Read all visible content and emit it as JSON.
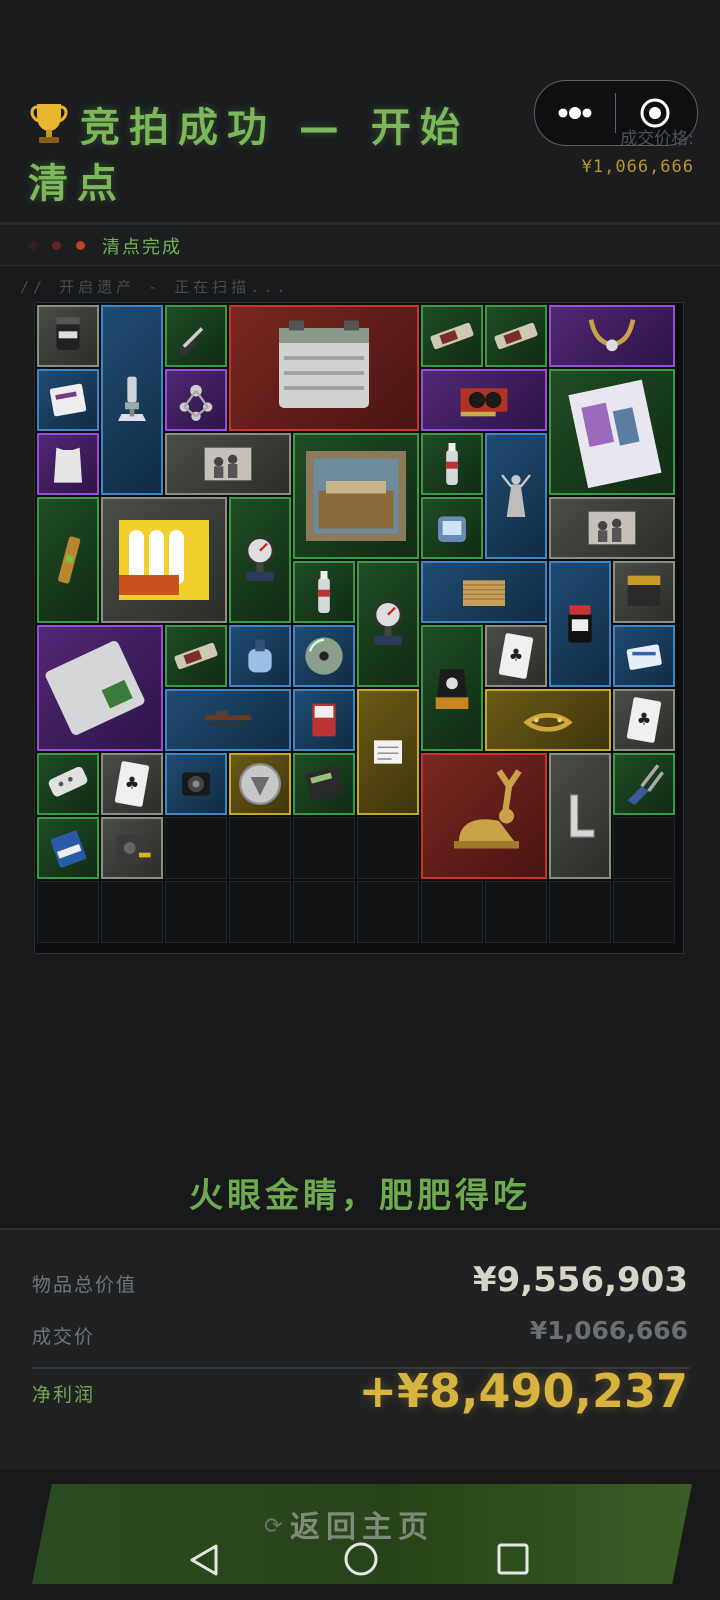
{
  "header": {
    "title": "竞拍成功 — 开始清点",
    "price_label": "成交价格:",
    "price_value": "¥1,066,666"
  },
  "capsule": {
    "more_icon": "more-dots-icon",
    "close_icon": "target-circle-icon"
  },
  "status": {
    "text": "清点完成",
    "dots": [
      "#3a1e1e",
      "#6b2222",
      "#c83a2e"
    ]
  },
  "scan": {
    "text": "// 开启遗产 - 正在扫描..."
  },
  "inventory": {
    "columns": 10,
    "rows": 10,
    "items": [
      {
        "name": "protein-jar",
        "rarity": "gray",
        "icon": "jar"
      },
      {
        "name": "microscope",
        "rarity": "blue",
        "icon": "microscope"
      },
      {
        "name": "screwdriver",
        "rarity": "green",
        "icon": "screwdriver"
      },
      {
        "name": "car-battery",
        "rarity": "red",
        "icon": "battery"
      },
      {
        "name": "snack-bar",
        "rarity": "green",
        "icon": "bar"
      },
      {
        "name": "snack-bar",
        "rarity": "green",
        "icon": "bar"
      },
      {
        "name": "horn-necklace",
        "rarity": "purple",
        "icon": "horns"
      },
      {
        "name": "medicine-pack",
        "rarity": "blue",
        "icon": "pack"
      },
      {
        "name": "molecule-model",
        "rarity": "purple",
        "icon": "molecule"
      },
      {
        "name": "graphics-card",
        "rarity": "purple",
        "icon": "gpu"
      },
      {
        "name": "magazine",
        "rarity": "green",
        "icon": "magazine"
      },
      {
        "name": "vest-plate",
        "rarity": "purple",
        "icon": "vest"
      },
      {
        "name": "old-photo",
        "rarity": "gray",
        "icon": "photo"
      },
      {
        "name": "painting",
        "rarity": "green",
        "icon": "painting"
      },
      {
        "name": "water-bottle",
        "rarity": "green",
        "icon": "bottle"
      },
      {
        "name": "statue",
        "rarity": "blue",
        "icon": "statue"
      },
      {
        "name": "spirit-level",
        "rarity": "green",
        "icon": "level"
      },
      {
        "name": "candles",
        "rarity": "gray",
        "icon": "candles"
      },
      {
        "name": "pressure-gauge",
        "rarity": "green",
        "icon": "gauge"
      },
      {
        "name": "device",
        "rarity": "green",
        "icon": "device"
      },
      {
        "name": "old-photo",
        "rarity": "gray",
        "icon": "photo"
      },
      {
        "name": "water-bottle",
        "rarity": "green",
        "icon": "bottle"
      },
      {
        "name": "pressure-gauge",
        "rarity": "green",
        "icon": "gauge"
      },
      {
        "name": "wicker-mat",
        "rarity": "blue",
        "icon": "mat"
      },
      {
        "name": "ink-bottle",
        "rarity": "blue",
        "icon": "ink"
      },
      {
        "name": "nails-box",
        "rarity": "gray",
        "icon": "box"
      },
      {
        "name": "hard-drive",
        "rarity": "purple",
        "icon": "hdd"
      },
      {
        "name": "snack-bar",
        "rarity": "green",
        "icon": "bar"
      },
      {
        "name": "fuel-tank",
        "rarity": "blue",
        "icon": "tank"
      },
      {
        "name": "cd-disc",
        "rarity": "blue",
        "icon": "disc"
      },
      {
        "name": "coffee-bag",
        "rarity": "green",
        "icon": "coffee"
      },
      {
        "name": "playing-card",
        "rarity": "gray",
        "icon": "card"
      },
      {
        "name": "pill-box",
        "rarity": "blue",
        "icon": "pillbox"
      },
      {
        "name": "rifle-parts",
        "rarity": "blue",
        "icon": "rifle"
      },
      {
        "name": "sd-card",
        "rarity": "blue",
        "icon": "sdcard"
      },
      {
        "name": "document",
        "rarity": "gold",
        "icon": "doc"
      },
      {
        "name": "laurel-crown",
        "rarity": "gold",
        "icon": "crown"
      },
      {
        "name": "playing-card",
        "rarity": "gray",
        "icon": "card"
      },
      {
        "name": "power-strip",
        "rarity": "green",
        "icon": "strip"
      },
      {
        "name": "playing-card",
        "rarity": "gray",
        "icon": "card"
      },
      {
        "name": "action-camera",
        "rarity": "blue",
        "icon": "camera"
      },
      {
        "name": "coin",
        "rarity": "gold",
        "icon": "coin"
      },
      {
        "name": "calculator",
        "rarity": "green",
        "icon": "calc"
      },
      {
        "name": "golden-deer",
        "rarity": "red",
        "icon": "deer"
      },
      {
        "name": "square-ruler",
        "rarity": "gray",
        "icon": "ruler"
      },
      {
        "name": "pliers",
        "rarity": "green",
        "icon": "pliers"
      },
      {
        "name": "battery-9v",
        "rarity": "green",
        "icon": "battery9v"
      },
      {
        "name": "tape-measure",
        "rarity": "gray",
        "icon": "tape"
      }
    ]
  },
  "slogan": "火眼金睛，肥肥得吃",
  "summary": {
    "total_label": "物品总价值",
    "total_value": "¥9,556,903",
    "deal_label": "成交价",
    "deal_value": "¥1,066,666",
    "profit_label": "净利润",
    "profit_value": "+¥8,490,237"
  },
  "return_button": {
    "label": "返回主页",
    "icon": "refresh-icon"
  },
  "navbar": {
    "back_icon": "back-triangle-icon",
    "home_icon": "home-circle-icon",
    "recent_icon": "recent-square-icon"
  },
  "colors": {
    "accent_green": "#7ab85a",
    "gold": "#d8b33e",
    "red": "#c6352a",
    "purple": "#9a4ed6",
    "blue": "#3f86c4",
    "green": "#3c9a40",
    "gray": "#8a8f84"
  }
}
